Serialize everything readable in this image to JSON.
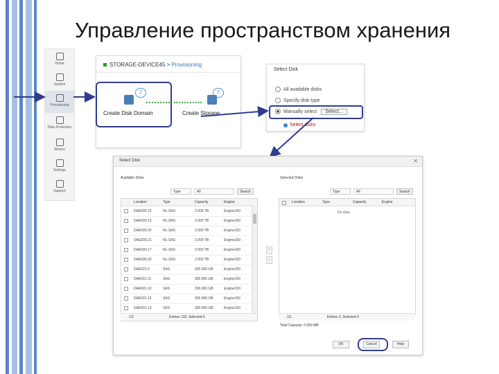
{
  "slide": {
    "title": "Управление пространством хранения"
  },
  "colors": {
    "stripe_blue": "#5b86c6",
    "stripe_light": "#a8bfe3",
    "annotation": "#2f3d8f",
    "link": "#2a7fc0",
    "warning": "#cc0000",
    "ok_green": "#2b9a2b"
  },
  "nav": {
    "items": [
      {
        "label": "Home",
        "icon": "home-icon"
      },
      {
        "label": "System",
        "icon": "system-icon"
      },
      {
        "label": "Provisioning",
        "icon": "provisioning-icon"
      },
      {
        "label": "Data Protection",
        "icon": "data-protection-icon"
      },
      {
        "label": "Shares",
        "icon": "shares-icon"
      },
      {
        "label": "Settings",
        "icon": "settings-icon"
      },
      {
        "label": "Support",
        "icon": "support-icon"
      }
    ]
  },
  "provisioning": {
    "device": "STORAGE-DEVICE45",
    "separator": ">",
    "current": "Provisioning",
    "step1": {
      "number": "2",
      "label": "Create Disk Domain"
    },
    "step2": {
      "number": "3",
      "label": "Create Storage"
    }
  },
  "select_disk_panel": {
    "title": "Select Disk",
    "options": [
      "All available disks",
      "Specify disk type",
      "Manually select"
    ],
    "select_button": "Select...",
    "warning": "Select disks"
  },
  "dialog": {
    "title": "Select Disk",
    "available_label": "Available Disks",
    "selected_label": "Selected Disks",
    "filter_type": "Type",
    "filter_all": "All",
    "search": "Search",
    "columns": [
      "Location",
      "Type",
      "Capacity",
      "Engine"
    ],
    "rows": [
      [
        "DAE000.15",
        "NL-SAS",
        "2.000 TB",
        "Engine150"
      ],
      [
        "DAE000.13",
        "NL-SAS",
        "2.000 TB",
        "Engine150"
      ],
      [
        "DAE000.20",
        "NL-SAS",
        "2.000 TB",
        "Engine150"
      ],
      [
        "DAE000.21",
        "NL-SAS",
        "2.000 TB",
        "Engine150"
      ],
      [
        "DAE000.17",
        "NL-SAS",
        "2.000 TB",
        "Engine150"
      ],
      [
        "DAE000.23",
        "NL-SAS",
        "2.000 TB",
        "Engine150"
      ],
      [
        "DAE001.5",
        "SAS",
        "300.000 GB",
        "Engine150"
      ],
      [
        "DAE001.11",
        "SAS",
        "300.000 GB",
        "Engine150"
      ],
      [
        "DAE001.10",
        "SAS",
        "300.000 GB",
        "Engine150"
      ],
      [
        "DAE001.12",
        "SAS",
        "300.000 GB",
        "Engine150"
      ],
      [
        "DAE001.13",
        "SAS",
        "300.000 GB",
        "Engine150"
      ]
    ],
    "no_data": "No data",
    "left_pager": "1/2",
    "left_entries": "Entries 133, Selected 0",
    "right_pager": "1/1",
    "right_entries": "Entries 0, Selected 0",
    "total_capacity": "Total Capacity: 0.000 MB",
    "ok": "OK",
    "cancel": "Cancel",
    "help": "Help"
  }
}
